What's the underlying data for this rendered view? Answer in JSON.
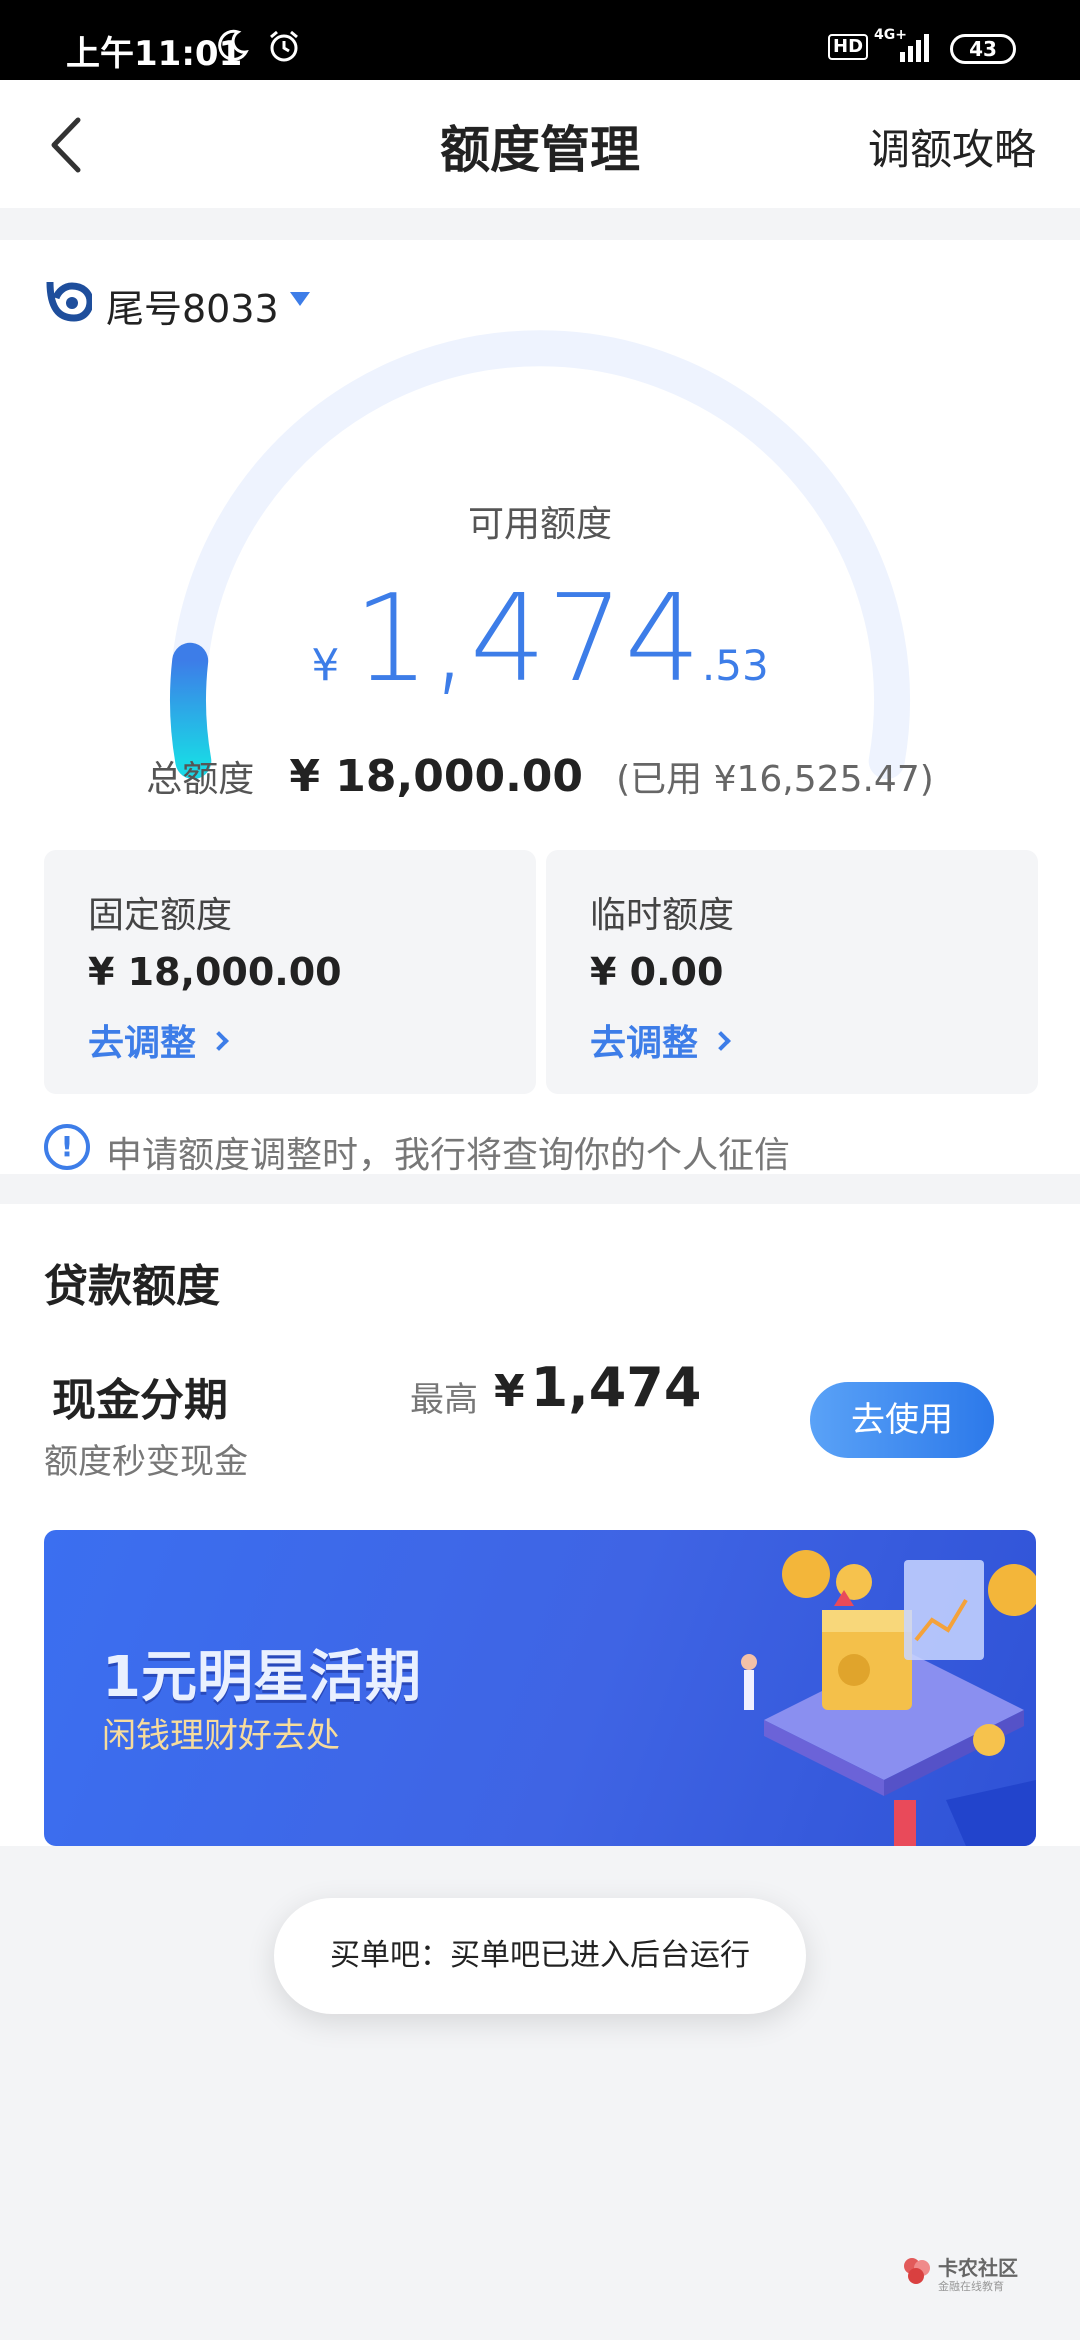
{
  "status_bar": {
    "time": "上午11:01",
    "hd": "HD",
    "network": "4G+",
    "battery": "43"
  },
  "nav": {
    "title": "额度管理",
    "right_link": "调额攻略"
  },
  "account": {
    "label": "尾号8033"
  },
  "available": {
    "label": "可用额度",
    "currency": "¥",
    "integer": "1,474",
    "decimal": ".53",
    "gauge_fraction": 0.082
  },
  "total": {
    "label": "总额度",
    "value": "¥ 18,000.00",
    "used": "(已用 ¥16,525.47)"
  },
  "fixed_limit": {
    "title": "固定额度",
    "value": "¥ 18,000.00",
    "link": "去调整"
  },
  "temp_limit": {
    "title": "临时额度",
    "value": "¥ 0.00",
    "link": "去调整"
  },
  "notice": {
    "icon": "!",
    "text": "申请额度调整时，我行将查询你的个人征信"
  },
  "loan": {
    "section_title": "贷款额度",
    "product_name": "现金分期",
    "product_sub": "额度秒变现金",
    "max_label": "最高",
    "currency": "¥",
    "max_amount": "1,474",
    "button": "去使用"
  },
  "banner": {
    "title": "1元明星活期",
    "subtitle": "闲钱理财好去处"
  },
  "toast": {
    "text": "买单吧：买单吧已进入后台运行"
  },
  "watermark": {
    "text": "卡农社区",
    "sub": "金融在线教育"
  },
  "colors": {
    "accent": "#3d7de8",
    "gauge_track": "#eef3fe",
    "gauge_fill_start": "#1bd6e6",
    "gauge_fill_end": "#3d7de8"
  }
}
